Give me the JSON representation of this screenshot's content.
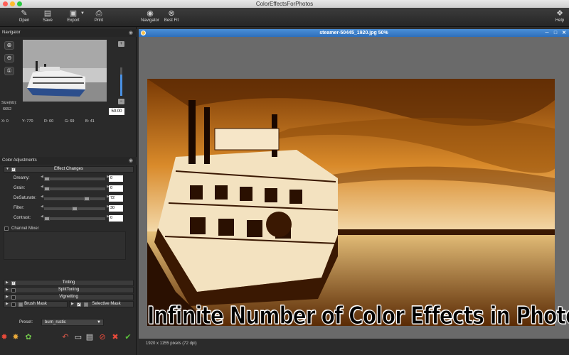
{
  "window": {
    "title": "ColorEffectsForPhotos"
  },
  "toolbar": {
    "open": "Open",
    "save": "Save",
    "export": "Export",
    "print": "Print",
    "navigator": "Navigator",
    "best_fit": "Best Fit",
    "help": "Help"
  },
  "navigator": {
    "title": "Navigator",
    "size_label": "Size(kb):",
    "size_value": "6652",
    "zoom_value": "50.00",
    "pixel_info": {
      "x": "X: 0",
      "y": "Y: 770",
      "r": "R: 60",
      "g": "G: 69",
      "b": "B: 41"
    }
  },
  "color_adjustments": {
    "title": "Color Adjustments",
    "effect_changes": "Effect Changes",
    "sliders": [
      {
        "label": "Dreamy:",
        "value": "0",
        "level": 0
      },
      {
        "label": "Grain:",
        "value": "0",
        "level": 0
      },
      {
        "label": "DeSaturate:",
        "value": "72",
        "level": 0.72
      },
      {
        "label": "Filter:",
        "value": "30",
        "level": 0.5
      },
      {
        "label": "Contrast:",
        "value": "0",
        "level": 0
      }
    ],
    "channel_mixer": "Channel Mixer",
    "tinting": "Tinting",
    "split_toning": "SplitToning",
    "vignetting": "Vignetting",
    "brush_mask": "Brush Mask",
    "selective_mask": "Selective Mask"
  },
  "preset": {
    "label": "Preset:",
    "value": "burn_rustic"
  },
  "document": {
    "title": "steamer-50445_1920.jpg 50%",
    "overlay_text": "Infinite Number of Color Effects in Photos",
    "status": "1920 x 1155 pixels (72 dpi)"
  },
  "colors": {
    "accent": "#4a90e2",
    "title_bar": "#2e6fba"
  }
}
